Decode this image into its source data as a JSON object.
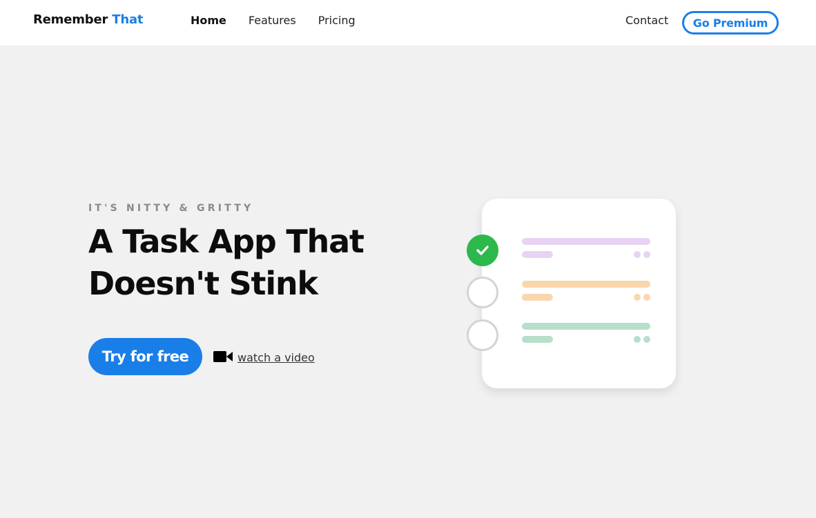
{
  "header": {
    "logo_main": "Remember",
    "logo_accent": "That",
    "nav": [
      {
        "label": "Home",
        "active": true
      },
      {
        "label": "Features",
        "active": false
      },
      {
        "label": "Pricing",
        "active": false
      }
    ],
    "contact_label": "Contact",
    "premium_label": "Go Premium"
  },
  "hero": {
    "eyebrow": "IT'S NITTY & GRITTY",
    "headline_line1": "A Task App That",
    "headline_line2": "Doesn't Stink",
    "cta_label": "Try for free",
    "video_label": "watch a video"
  },
  "illustration": {
    "tasks": [
      {
        "completed": true,
        "color": "#e8d3f3"
      },
      {
        "completed": false,
        "color": "#f9d6ac"
      },
      {
        "completed": false,
        "color": "#b6dfca"
      }
    ]
  },
  "colors": {
    "accent": "#1a7ee8",
    "check_green": "#2cb84a",
    "page_bg": "#f1f1f1"
  },
  "icons": {
    "video": "video-camera-icon",
    "check": "check-icon"
  }
}
